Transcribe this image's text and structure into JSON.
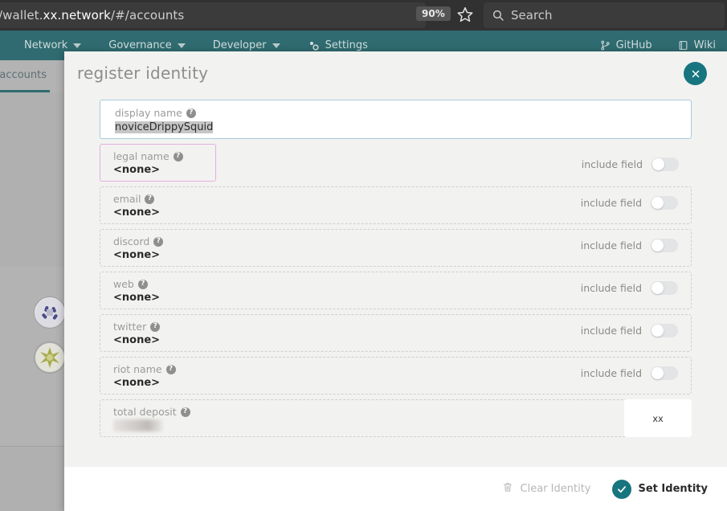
{
  "browser": {
    "url_prefix": "/wallet.",
    "url_host": "xx.network",
    "url_suffix": "/#/accounts",
    "zoom_level": "90%",
    "search_placeholder": "Search",
    "star_icon": "star-bookmark-icon",
    "search_icon": "search-icon"
  },
  "nav": {
    "left_items": [
      {
        "label": "Network",
        "has_caret": true,
        "icon": ""
      },
      {
        "label": "Governance",
        "has_caret": true,
        "icon": ""
      },
      {
        "label": "Developer",
        "has_caret": true,
        "icon": ""
      },
      {
        "label": "Settings",
        "has_caret": false,
        "icon": "gear-icon"
      }
    ],
    "right_items": [
      {
        "label": "GitHub",
        "icon": "git-branch-icon"
      },
      {
        "label": "Wiki",
        "icon": "book-icon"
      }
    ]
  },
  "background": {
    "active_tab": "y accounts"
  },
  "modal": {
    "title": "register identity",
    "close_icon": "close-icon",
    "display_name": {
      "label": "display name",
      "help_icon": "help-icon",
      "value": "noviceDrippySquid",
      "selected": true
    },
    "fields": [
      {
        "label": "legal name",
        "value": "<none>",
        "include_label": "include field",
        "toggle_on": false,
        "highlighted": true
      },
      {
        "label": "email",
        "value": "<none>",
        "include_label": "include field",
        "toggle_on": false,
        "highlighted": false
      },
      {
        "label": "discord",
        "value": "<none>",
        "include_label": "include field",
        "toggle_on": false,
        "highlighted": false
      },
      {
        "label": "web",
        "value": "<none>",
        "include_label": "include field",
        "toggle_on": false,
        "highlighted": false
      },
      {
        "label": "twitter",
        "value": "<none>",
        "include_label": "include field",
        "toggle_on": false,
        "highlighted": false
      },
      {
        "label": "riot name",
        "value": "<none>",
        "include_label": "include field",
        "toggle_on": false,
        "highlighted": false
      }
    ],
    "deposit": {
      "label": "total deposit",
      "value_redacted": true,
      "unit": "xx"
    },
    "footer": {
      "clear_label": "Clear Identity",
      "clear_icon": "trash-icon",
      "clear_disabled": true,
      "set_label": "Set Identity",
      "set_icon": "check-circle-icon"
    }
  },
  "colors": {
    "teal": "#2f6b70",
    "accent": "#17757f",
    "highlight_border": "#e7aee0",
    "input_border": "#a7cbdd"
  }
}
